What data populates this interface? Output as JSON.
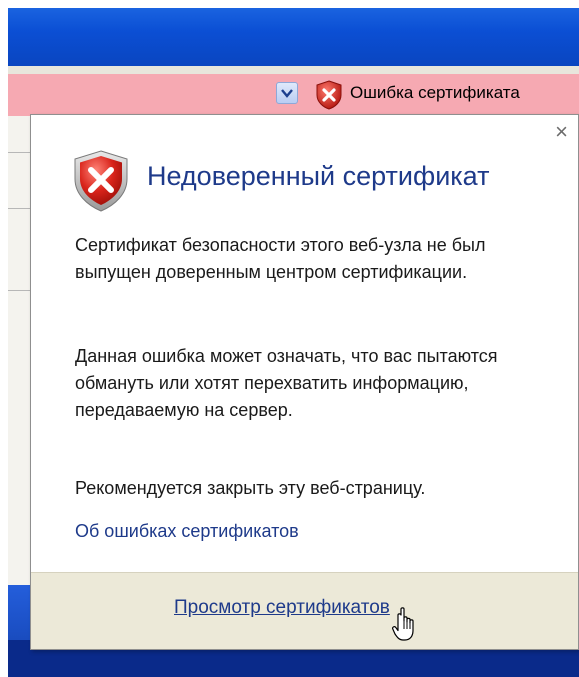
{
  "certbar": {
    "error_label": "Ошибка сертификата",
    "icon": "shield-error-icon",
    "dropdown_icon": "chevron-down-icon"
  },
  "popup": {
    "title": "Недоверенный сертификат",
    "title_icon": "shield-error-icon",
    "close_label": "×",
    "paragraph_1": "Сертификат безопасности этого веб-узла не был выпущен доверенным центром сертификации.",
    "paragraph_2": "Данная ошибка может означать, что вас пытаются обмануть или хотят перехватить информацию, передаваемую на сервер.",
    "recommendation": "Рекомендуется закрыть эту веб-страницу.",
    "about_link": "Об ошибках сертификатов",
    "view_link": "Просмотр сертификатов"
  },
  "colors": {
    "certbar_bg": "#f6a9b2",
    "link": "#1e3a8a",
    "titlebar": "#0b4fd4",
    "footer_bg": "#ece9d8"
  }
}
